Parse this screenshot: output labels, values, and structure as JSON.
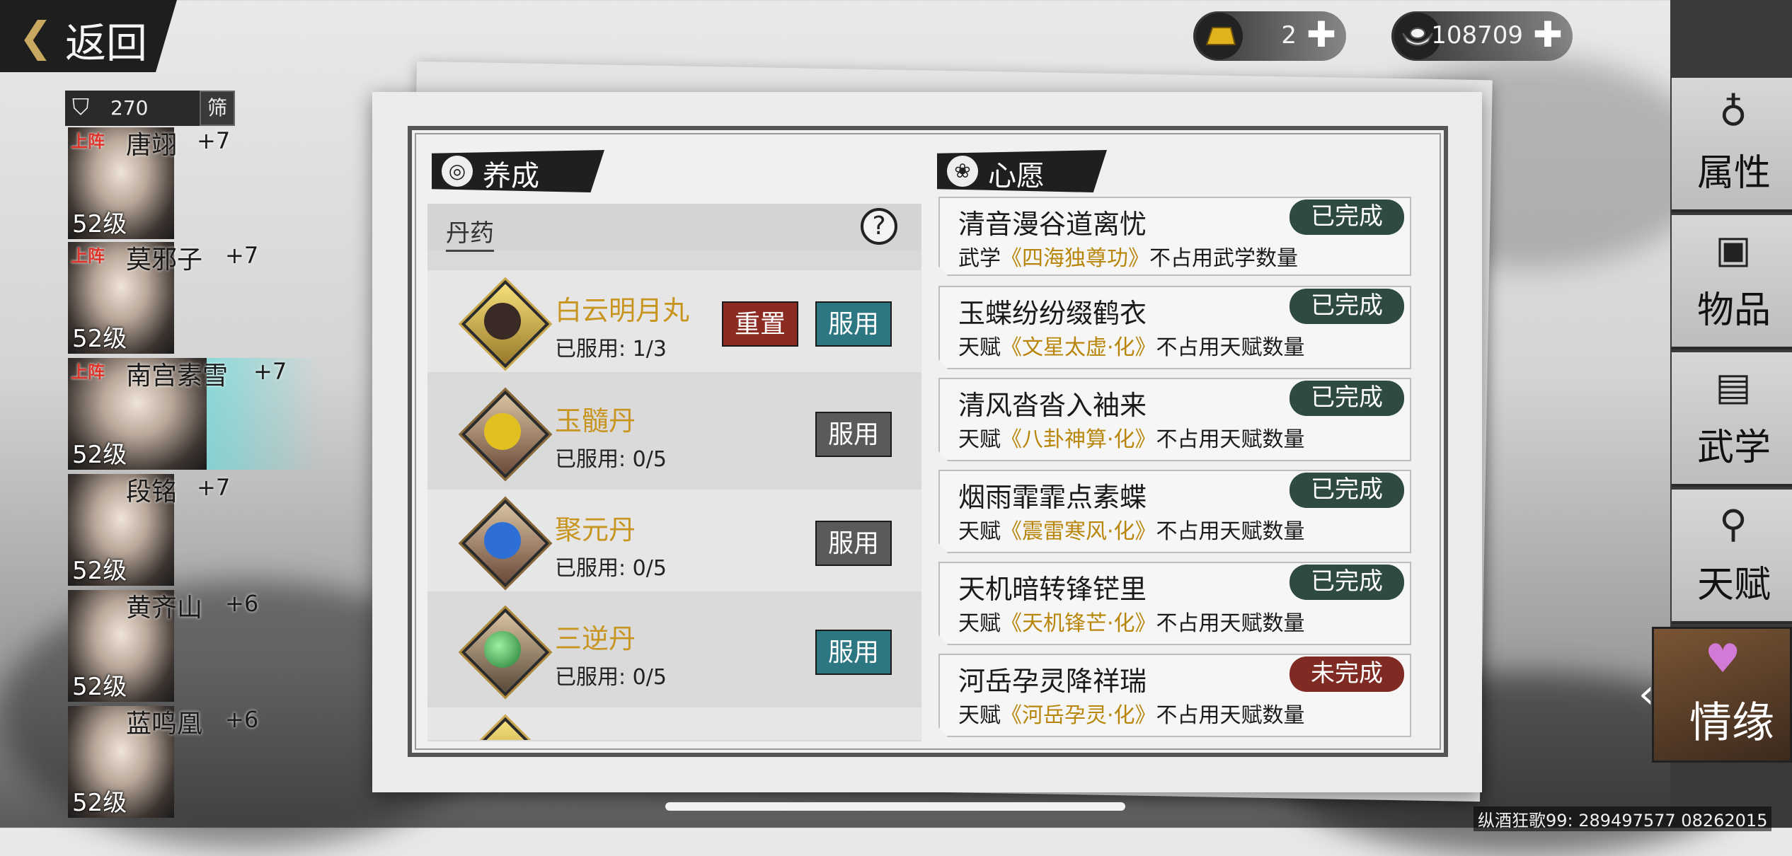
{
  "nav": {
    "back_label": "返回"
  },
  "currency": [
    {
      "icon": "gold-bar-icon",
      "value": "2"
    },
    {
      "icon": "silver-ingot-icon",
      "value": "108709"
    }
  ],
  "roster": {
    "count": "270",
    "filter_label": "筛",
    "heroes": [
      {
        "name": "唐翊",
        "bonus": "+7",
        "level": "52级",
        "on_team": "上阵",
        "selected": false
      },
      {
        "name": "莫邪子",
        "bonus": "+7",
        "level": "52级",
        "on_team": "上阵",
        "selected": false
      },
      {
        "name": "南宫素雪",
        "bonus": "+7",
        "level": "52级",
        "on_team": "上阵",
        "selected": true
      },
      {
        "name": "段铭",
        "bonus": "+7",
        "level": "52级",
        "on_team": "",
        "selected": false
      },
      {
        "name": "黄齐山",
        "bonus": "+6",
        "level": "52级",
        "on_team": "",
        "selected": false
      },
      {
        "name": "蓝鸣凰",
        "bonus": "+6",
        "level": "52级",
        "on_team": "",
        "selected": false
      }
    ]
  },
  "cultivate": {
    "title": "养成",
    "category": "丹药",
    "help": "?",
    "pills": [
      {
        "name": "白云明月丸",
        "used": "已服用: 1/3",
        "reset": "重置",
        "use": "服用",
        "use_enabled": true,
        "color": "#c9c9c9"
      },
      {
        "name": "玉髓丹",
        "used": "已服用: 0/5",
        "reset": "",
        "use": "服用",
        "use_enabled": false,
        "color": "#e2c022"
      },
      {
        "name": "聚元丹",
        "used": "已服用: 0/5",
        "reset": "",
        "use": "服用",
        "use_enabled": false,
        "color": "#2e6fd6"
      },
      {
        "name": "三逆丹",
        "used": "已服用: 0/5",
        "reset": "",
        "use": "服用",
        "use_enabled": true,
        "color": "#2fa84a"
      }
    ]
  },
  "wishes": {
    "title": "心愿",
    "items": [
      {
        "title": "清音漫谷道离忧",
        "pre": "武学",
        "hl": "《四海独尊功》",
        "post": "不占用武学数量",
        "status": "已完成",
        "done": true
      },
      {
        "title": "玉蝶纷纷缀鹤衣",
        "pre": "天赋",
        "hl": "《文星太虚·化》",
        "post": "不占用天赋数量",
        "status": "已完成",
        "done": true
      },
      {
        "title": "清风沓沓入袖来",
        "pre": "天赋",
        "hl": "《八卦神算·化》",
        "post": "不占用天赋数量",
        "status": "已完成",
        "done": true
      },
      {
        "title": "烟雨霏霏点素蝶",
        "pre": "天赋",
        "hl": "《震雷寒风·化》",
        "post": "不占用天赋数量",
        "status": "已完成",
        "done": true
      },
      {
        "title": "天机暗转锋铓里",
        "pre": "天赋",
        "hl": "《天机锋芒·化》",
        "post": "不占用天赋数量",
        "status": "已完成",
        "done": true
      },
      {
        "title": "河岳孕灵降祥瑞",
        "pre": "天赋",
        "hl": "《河岳孕灵·化》",
        "post": "不占用天赋数量",
        "status": "未完成",
        "done": false
      }
    ]
  },
  "side_tabs": [
    {
      "label": "属性",
      "icon": "gourd-icon"
    },
    {
      "label": "物品",
      "icon": "gift-box-icon"
    },
    {
      "label": "武学",
      "icon": "book-icon"
    },
    {
      "label": "天赋",
      "icon": "talent-icon"
    },
    {
      "label": "情缘",
      "icon": "heart-icon",
      "active": true
    }
  ],
  "footer": "纵酒狂歌99: 289497577  08262015"
}
